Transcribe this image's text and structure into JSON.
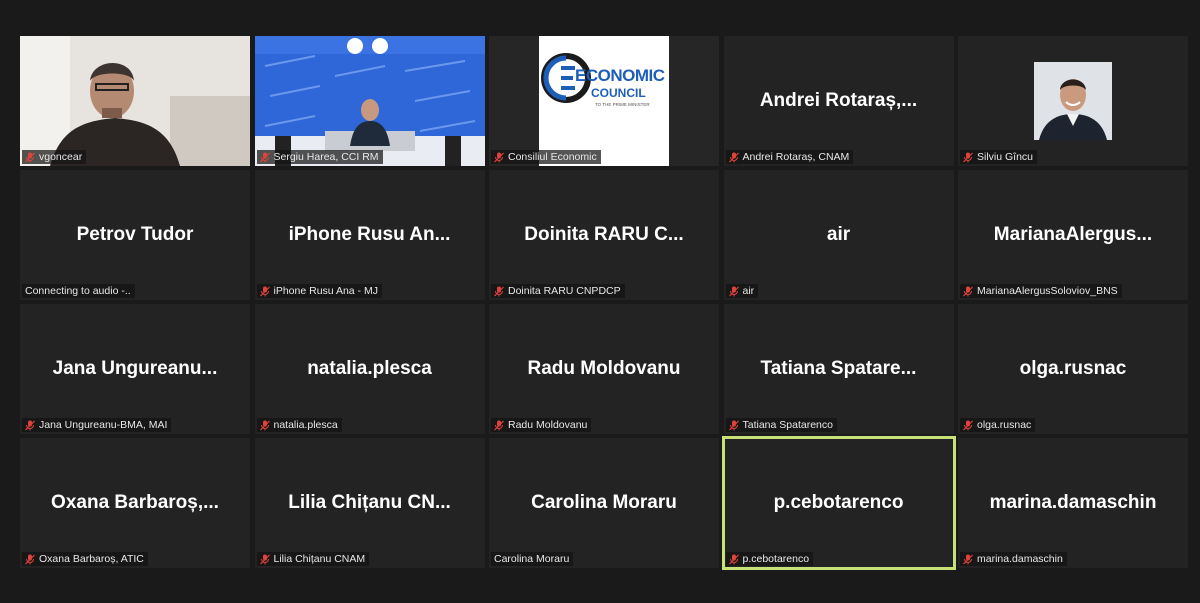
{
  "participants": [
    {
      "display": "",
      "label": "vgoncear",
      "muted": true,
      "kind": "video"
    },
    {
      "display": "",
      "label": "Sergiu Harea, CCI RM",
      "muted": true,
      "kind": "video"
    },
    {
      "display": "",
      "label": "Consiliul Economic",
      "muted": true,
      "kind": "logo"
    },
    {
      "display": "Andrei  Rotaraș,...",
      "label": "Andrei Rotaraș, CNAM",
      "muted": true,
      "kind": "name"
    },
    {
      "display": "",
      "label": "Silviu Gîncu",
      "muted": true,
      "kind": "photo"
    },
    {
      "display": "Petrov Tudor",
      "label": "Connecting to audio -..",
      "muted": false,
      "kind": "name"
    },
    {
      "display": "iPhone  Rusu  An...",
      "label": "iPhone Rusu Ana - MJ",
      "muted": true,
      "kind": "name"
    },
    {
      "display": "Doinita  RARU  C...",
      "label": "Doinita RARU CNPDCP",
      "muted": true,
      "kind": "name"
    },
    {
      "display": "air",
      "label": "air",
      "muted": true,
      "kind": "name"
    },
    {
      "display": "MarianaAlergus...",
      "label": "MarianaAlergusSoloviov_BNS",
      "muted": true,
      "kind": "name"
    },
    {
      "display": "Jana  Ungureanu...",
      "label": "Jana Ungureanu-BMA, MAI",
      "muted": true,
      "kind": "name"
    },
    {
      "display": "natalia.plesca",
      "label": "natalia.plesca",
      "muted": true,
      "kind": "name"
    },
    {
      "display": "Radu Moldovanu",
      "label": "Radu Moldovanu",
      "muted": true,
      "kind": "name"
    },
    {
      "display": "Tatiana  Spatare...",
      "label": "Tatiana Spatarenco",
      "muted": true,
      "kind": "name"
    },
    {
      "display": "olga.rusnac",
      "label": "olga.rusnac",
      "muted": true,
      "kind": "name"
    },
    {
      "display": "Oxana  Barbaroș,...",
      "label": "Oxana Barbaroș, ATIC",
      "muted": true,
      "kind": "name"
    },
    {
      "display": "Lilia  Chițanu  CN...",
      "label": "Lilia Chițanu CNAM",
      "muted": true,
      "kind": "name"
    },
    {
      "display": "Carolina Moraru",
      "label": "Carolina Moraru",
      "muted": false,
      "kind": "name"
    },
    {
      "display": "p.cebotarenco",
      "label": "p.cebotarenco",
      "muted": true,
      "kind": "name",
      "active": true
    },
    {
      "display": "marina.damaschin",
      "label": "marina.damaschin",
      "muted": true,
      "kind": "name"
    }
  ],
  "logo": {
    "line1": "ECONOMIC",
    "line2": "COUNCIL",
    "line3": "TO THE PRIME MINISTER"
  },
  "colors": {
    "background": "#1a1a1a",
    "tile": "#232323",
    "active_speaker": "#c8e27a",
    "muted_icon": "#e0433a"
  }
}
